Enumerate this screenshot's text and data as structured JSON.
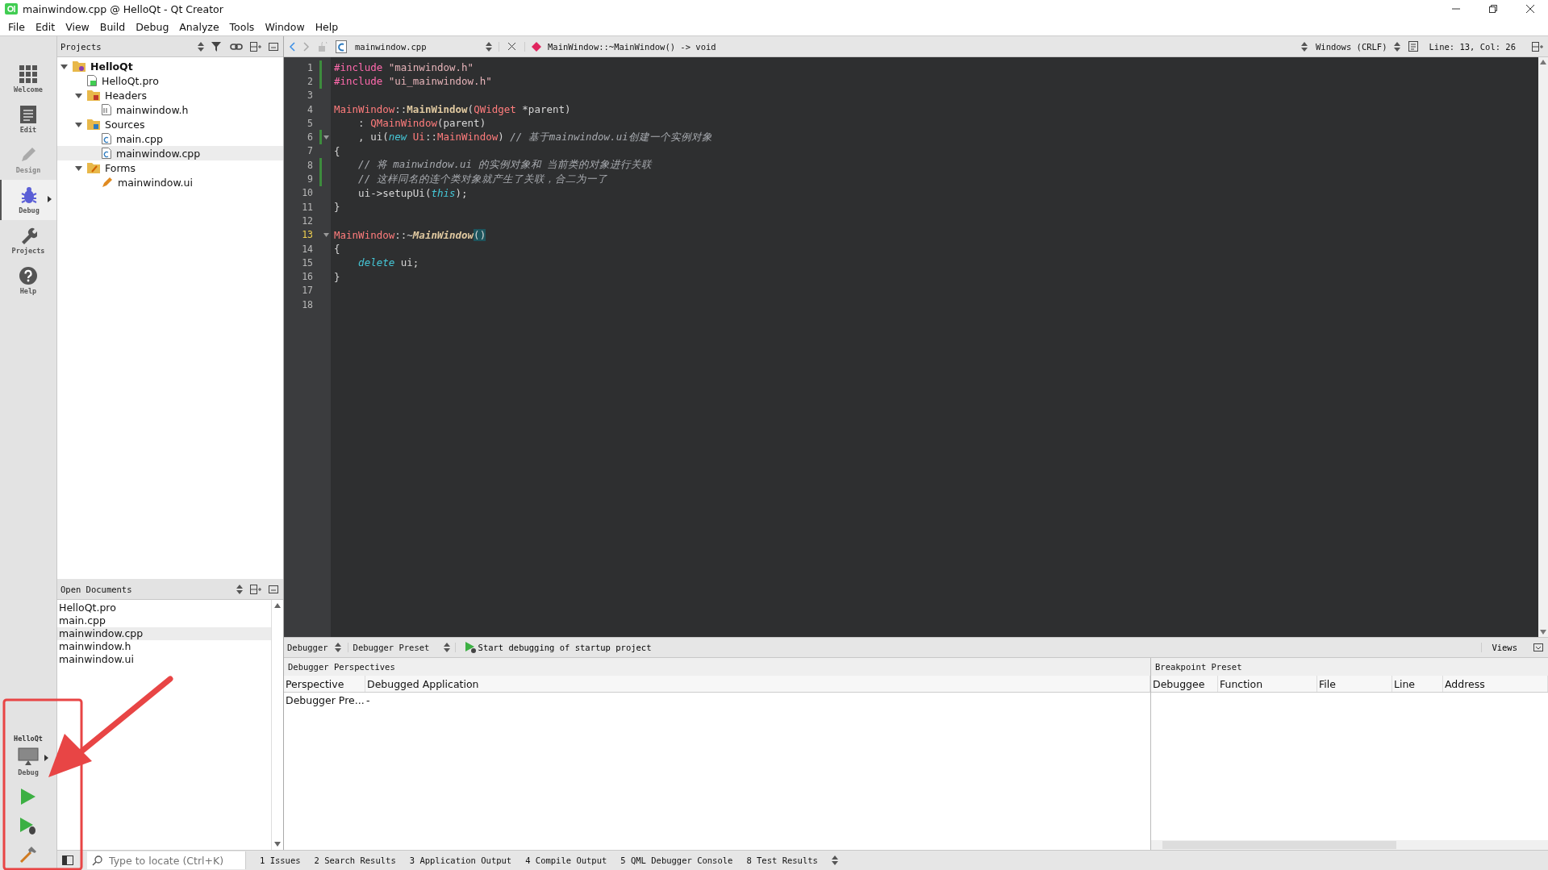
{
  "window": {
    "title": "mainwindow.cpp @ HelloQt - Qt Creator"
  },
  "menu": [
    "File",
    "Edit",
    "View",
    "Build",
    "Debug",
    "Analyze",
    "Tools",
    "Window",
    "Help"
  ],
  "modes": [
    {
      "label": "Welcome",
      "kind": "welcome",
      "selected": false,
      "disabled": false
    },
    {
      "label": "Edit",
      "kind": "edit",
      "selected": false,
      "disabled": false
    },
    {
      "label": "Design",
      "kind": "design",
      "selected": false,
      "disabled": true
    },
    {
      "label": "Debug",
      "kind": "debug",
      "selected": true,
      "disabled": false
    },
    {
      "label": "Projects",
      "kind": "projects",
      "selected": false,
      "disabled": false
    },
    {
      "label": "Help",
      "kind": "help",
      "selected": false,
      "disabled": false
    }
  ],
  "kit": {
    "project": "HelloQt",
    "build": "Debug"
  },
  "projects_panel": {
    "title": "Projects",
    "tree": [
      {
        "label": "HelloQt",
        "kind": "project",
        "expanded": true,
        "selected": false,
        "children": [
          {
            "label": "HelloQt.pro",
            "kind": "pro",
            "selected": false
          },
          {
            "label": "Headers",
            "kind": "headers",
            "expanded": true,
            "selected": false,
            "children": [
              {
                "label": "mainwindow.h",
                "kind": "header",
                "selected": false
              }
            ]
          },
          {
            "label": "Sources",
            "kind": "sources",
            "expanded": true,
            "selected": false,
            "children": [
              {
                "label": "main.cpp",
                "kind": "source",
                "selected": false
              },
              {
                "label": "mainwindow.cpp",
                "kind": "source",
                "selected": true
              }
            ]
          },
          {
            "label": "Forms",
            "kind": "forms",
            "expanded": true,
            "selected": false,
            "children": [
              {
                "label": "mainwindow.ui",
                "kind": "form",
                "selected": false
              }
            ]
          }
        ]
      }
    ]
  },
  "open_documents": {
    "title": "Open Documents",
    "items": [
      {
        "label": "HelloQt.pro",
        "selected": false
      },
      {
        "label": "main.cpp",
        "selected": false
      },
      {
        "label": "mainwindow.cpp",
        "selected": true
      },
      {
        "label": "mainwindow.h",
        "selected": false
      },
      {
        "label": "mainwindow.ui",
        "selected": false
      }
    ]
  },
  "editor_toolbar": {
    "file": "mainwindow.cpp",
    "symbol": "MainWindow::~MainWindow() -> void",
    "line_ending": "Windows (CRLF)",
    "position": "Line: 13, Col: 26"
  },
  "editor": {
    "lines": [
      {
        "number": "1",
        "modified": true,
        "fold": false,
        "current": false,
        "tokens": [
          {
            "kind": "pre",
            "text": "#include"
          },
          {
            "kind": "str",
            "text": " \"mainwindow.h\""
          }
        ]
      },
      {
        "number": "2",
        "modified": true,
        "fold": false,
        "current": false,
        "tokens": [
          {
            "kind": "pre",
            "text": "#include"
          },
          {
            "kind": "str",
            "text": " \"ui_mainwindow.h\""
          }
        ]
      },
      {
        "number": "3",
        "modified": false,
        "fold": false,
        "current": false
      },
      {
        "number": "4",
        "modified": false,
        "fold": false,
        "current": false,
        "tokens": [
          {
            "kind": "type",
            "text": "MainWindow"
          },
          {
            "kind": "plain",
            "text": "::"
          },
          {
            "kind": "fn",
            "text": "MainWindow"
          },
          {
            "kind": "plain",
            "text": "("
          },
          {
            "kind": "type",
            "text": "QWidget"
          },
          {
            "kind": "plain",
            "text": " *parent)"
          }
        ]
      },
      {
        "number": "5",
        "modified": false,
        "fold": false,
        "current": false,
        "tokens": [
          {
            "kind": "plain",
            "text": "    : "
          },
          {
            "kind": "type",
            "text": "QMainWindow"
          },
          {
            "kind": "plain",
            "text": "(parent)"
          }
        ]
      },
      {
        "number": "6",
        "modified": true,
        "fold": true,
        "current": false,
        "tokens": [
          {
            "kind": "plain",
            "text": "    , ui("
          },
          {
            "kind": "kw",
            "text": "new"
          },
          {
            "kind": "type",
            "text": " Ui"
          },
          {
            "kind": "plain",
            "text": "::"
          },
          {
            "kind": "type",
            "text": "MainWindow"
          },
          {
            "kind": "plain",
            "text": ") "
          },
          {
            "kind": "cm",
            "text": "// 基于mainwindow.ui创建一个实例对象"
          }
        ]
      },
      {
        "number": "7",
        "modified": false,
        "fold": false,
        "current": false,
        "tokens": [
          {
            "kind": "plain",
            "text": "{"
          }
        ]
      },
      {
        "number": "8",
        "modified": true,
        "fold": false,
        "current": false,
        "tokens": [
          {
            "kind": "cm",
            "text": "    // 将 mainwindow.ui 的实例对象和 当前类的对象进行关联"
          }
        ]
      },
      {
        "number": "9",
        "modified": true,
        "fold": false,
        "current": false,
        "tokens": [
          {
            "kind": "cm",
            "text": "    // 这样同名的连个类对象就产生了关联，合二为一了"
          }
        ]
      },
      {
        "number": "10",
        "modified": false,
        "fold": false,
        "current": false,
        "tokens": [
          {
            "kind": "plain",
            "text": "    ui->setupUi("
          },
          {
            "kind": "kw",
            "text": "this"
          },
          {
            "kind": "plain",
            "text": ");"
          }
        ]
      },
      {
        "number": "11",
        "modified": false,
        "fold": false,
        "current": false,
        "tokens": [
          {
            "kind": "plain",
            "text": "}"
          }
        ]
      },
      {
        "number": "12",
        "modified": false,
        "fold": false,
        "current": false
      },
      {
        "number": "13",
        "modified": false,
        "fold": true,
        "current": true,
        "tokens": [
          {
            "kind": "type",
            "text": "MainWindow"
          },
          {
            "kind": "plain",
            "text": "::~"
          },
          {
            "kind": "dtor",
            "text": "MainWindow"
          },
          {
            "kind": "match",
            "text": "()"
          }
        ]
      },
      {
        "number": "14",
        "modified": false,
        "fold": false,
        "current": false,
        "tokens": [
          {
            "kind": "plain",
            "text": "{"
          }
        ]
      },
      {
        "number": "15",
        "modified": false,
        "fold": false,
        "current": false,
        "tokens": [
          {
            "kind": "kw",
            "text": "    delete"
          },
          {
            "kind": "plain",
            "text": " ui;"
          }
        ]
      },
      {
        "number": "16",
        "modified": false,
        "fold": false,
        "current": false,
        "tokens": [
          {
            "kind": "plain",
            "text": "}"
          }
        ]
      },
      {
        "number": "17",
        "modified": false,
        "fold": false,
        "current": false
      },
      {
        "number": "18",
        "modified": false,
        "fold": false,
        "current": false
      }
    ]
  },
  "debugger_bar": {
    "engine": "Debugger",
    "preset": "Debugger Preset",
    "start": "Start debugging of startup project",
    "views": "Views"
  },
  "perspectives": {
    "title": "Debugger Perspectives",
    "columns": [
      "Perspective",
      "Debugged Application"
    ],
    "rows": [
      [
        "Debugger Pre...",
        "-"
      ]
    ]
  },
  "breakpoints": {
    "title": "Breakpoint Preset",
    "columns": [
      "Debuggee",
      "Function",
      "File",
      "Line",
      "Address"
    ]
  },
  "locator": {
    "placeholder": "Type to locate (Ctrl+K)"
  },
  "output_tabs": [
    "1  Issues",
    "2  Search Results",
    "3  Application Output",
    "4  Compile Output",
    "5  QML Debugger Console",
    "8  Test Results"
  ]
}
